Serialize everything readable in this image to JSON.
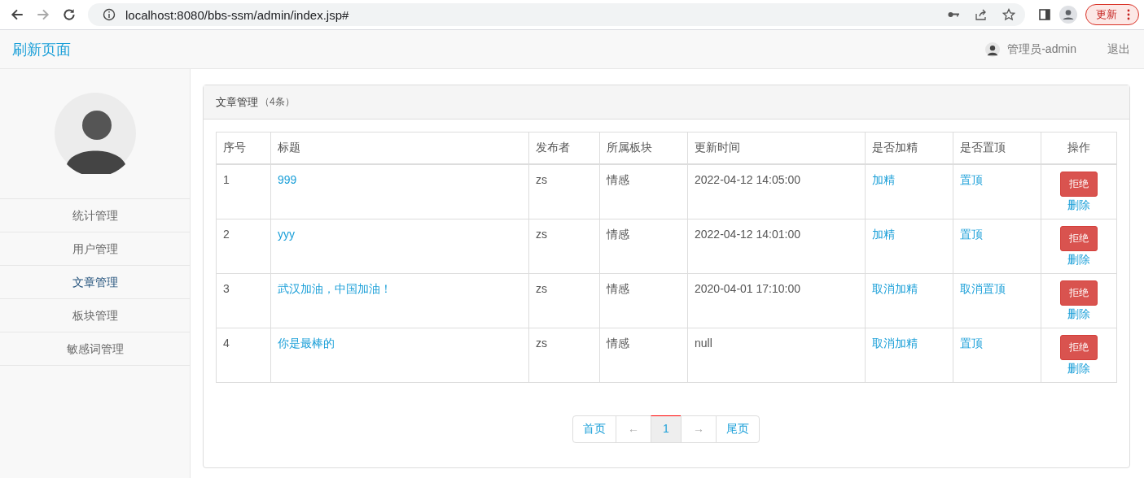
{
  "browser": {
    "url": "localhost:8080/bbs-ssm/admin/index.jsp#",
    "update_button": "更新"
  },
  "navbar": {
    "brand": "刷新页面",
    "user": "管理员-admin",
    "logout": "退出"
  },
  "sidebar": {
    "items": [
      {
        "label": "统计管理",
        "selected": false
      },
      {
        "label": "用户管理",
        "selected": false
      },
      {
        "label": "文章管理",
        "selected": true
      },
      {
        "label": "板块管理",
        "selected": false
      },
      {
        "label": "敏感词管理",
        "selected": false
      }
    ]
  },
  "panel": {
    "title": "文章管理",
    "count": "（4条）"
  },
  "table": {
    "columns": [
      "序号",
      "标题",
      "发布者",
      "所属板块",
      "更新时间",
      "是否加精",
      "是否置顶",
      "操作"
    ],
    "rows": [
      {
        "index": "1",
        "title": "999",
        "author": "zs",
        "board": "情感",
        "updated": "2022-04-12 14:05:00",
        "featured_action": "加精",
        "top_action": "置顶",
        "reject": "拒绝",
        "delete": "删除"
      },
      {
        "index": "2",
        "title": "yyy",
        "author": "zs",
        "board": "情感",
        "updated": "2022-04-12 14:01:00",
        "featured_action": "加精",
        "top_action": "置顶",
        "reject": "拒绝",
        "delete": "删除"
      },
      {
        "index": "3",
        "title": "武汉加油，中国加油！",
        "author": "zs",
        "board": "情感",
        "updated": "2020-04-01 17:10:00",
        "featured_action": "取消加精",
        "top_action": "取消置顶",
        "reject": "拒绝",
        "delete": "删除"
      },
      {
        "index": "4",
        "title": "你是最棒的",
        "author": "zs",
        "board": "情感",
        "updated": "null",
        "featured_action": "取消加精",
        "top_action": "置顶",
        "reject": "拒绝",
        "delete": "删除"
      }
    ]
  },
  "pagination": [
    {
      "label": "首页",
      "selected": false,
      "disabled": false
    },
    {
      "label": "←",
      "selected": false,
      "disabled": true
    },
    {
      "label": "1",
      "selected": true,
      "disabled": false
    },
    {
      "label": "→",
      "selected": false,
      "disabled": true
    },
    {
      "label": "尾页",
      "selected": false,
      "disabled": false
    }
  ]
}
